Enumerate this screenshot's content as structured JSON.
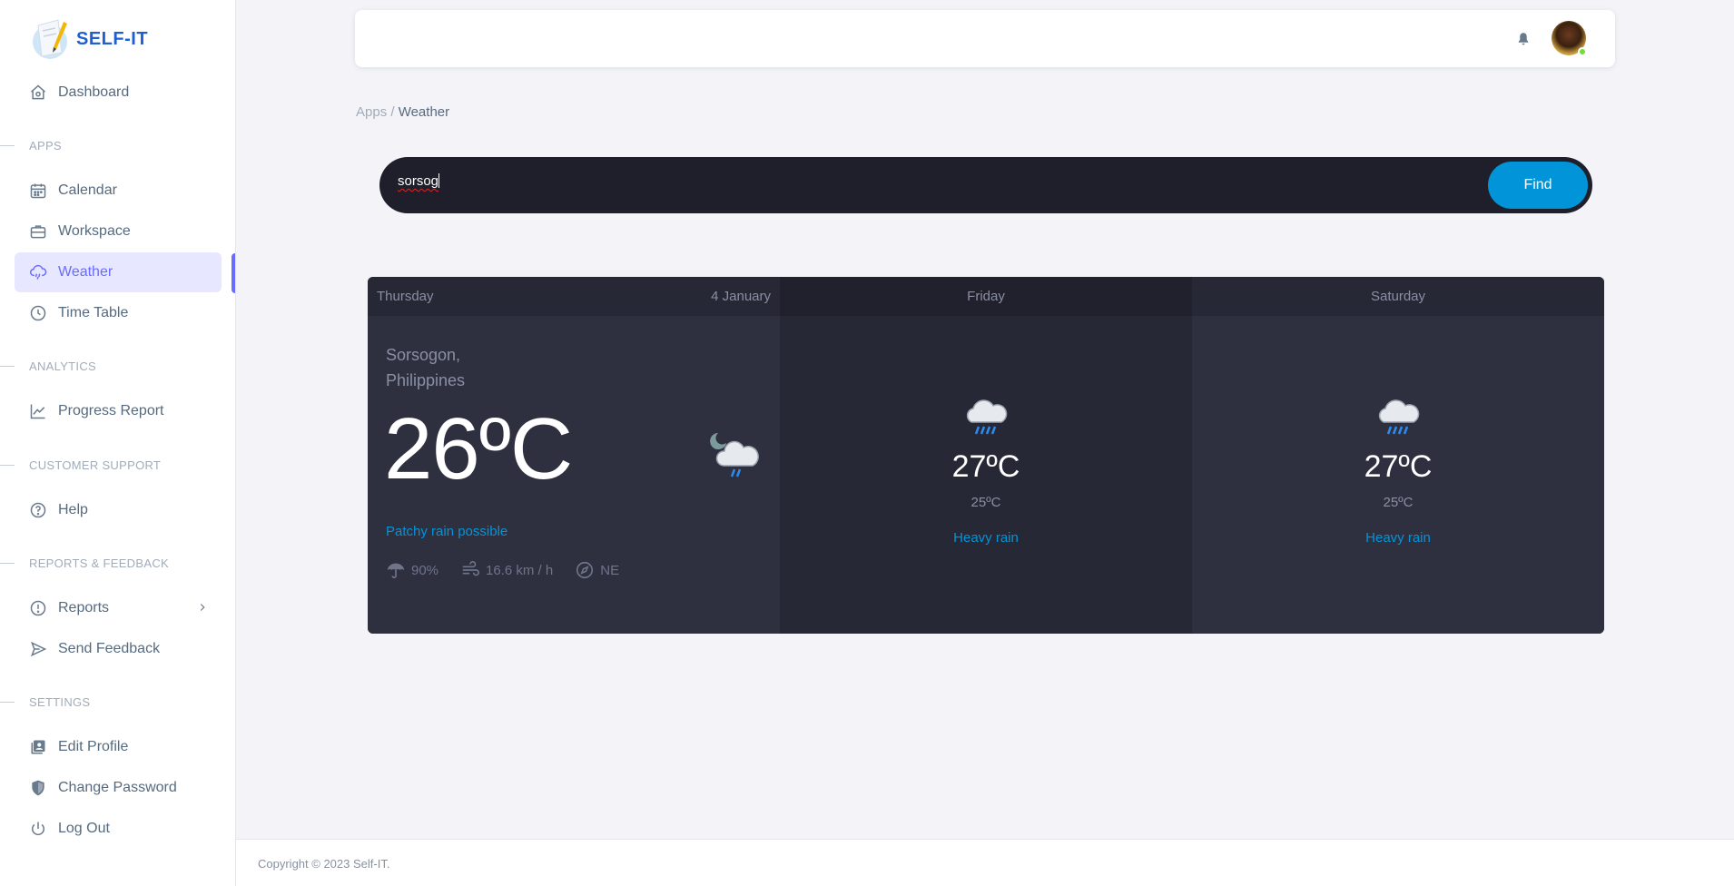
{
  "app": {
    "name": "SELF-IT"
  },
  "sidebar": {
    "dashboard": "Dashboard",
    "sections": {
      "apps": "APPS",
      "analytics": "ANALYTICS",
      "support": "CUSTOMER SUPPORT",
      "reports": "REPORTS & FEEDBACK",
      "settings": "SETTINGS"
    },
    "items": {
      "calendar": "Calendar",
      "workspace": "Workspace",
      "weather": "Weather",
      "timetable": "Time Table",
      "progress": "Progress Report",
      "help": "Help",
      "reports": "Reports",
      "feedback": "Send Feedback",
      "edit_profile": "Edit Profile",
      "change_password": "Change Password",
      "logout": "Log Out"
    },
    "active_item": "Weather"
  },
  "breadcrumb": {
    "parent": "Apps /",
    "current": "Weather"
  },
  "search": {
    "value": "sorsog",
    "button": "Find"
  },
  "weather": {
    "today": {
      "day": "Thursday",
      "date": "4 January",
      "location_line1": "Sorsogon,",
      "location_line2": "Philippines",
      "temp": "26ºC",
      "condition": "Patchy rain possible",
      "humidity": "90%",
      "wind": "16.6 km / h",
      "direction": "NE",
      "icon": "partly-cloudy-night-rain-icon"
    },
    "forecast": [
      {
        "day": "Friday",
        "temp": "27ºC",
        "low": "25ºC",
        "condition": "Heavy rain",
        "icon": "heavy-rain-icon"
      },
      {
        "day": "Saturday",
        "temp": "27ºC",
        "low": "25ºC",
        "condition": "Heavy rain",
        "icon": "heavy-rain-icon"
      }
    ]
  },
  "colors": {
    "accent": "#696cff",
    "brand": "#1f5fd1",
    "find_button": "#0294d8",
    "card_dark": "#2e3040"
  },
  "footer": {
    "copyright": "Copyright © 2023 Self-IT."
  }
}
